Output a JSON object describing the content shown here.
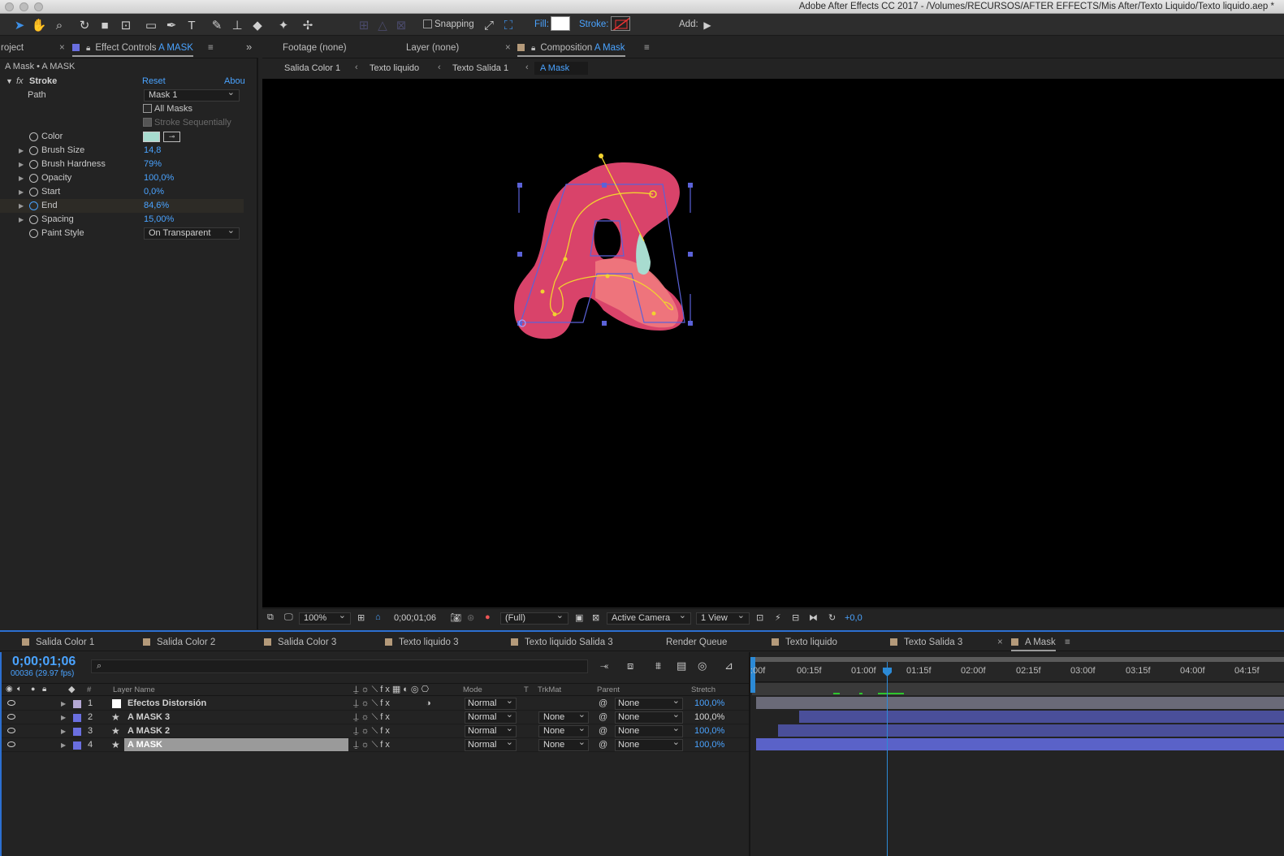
{
  "window": {
    "title": "Adobe After Effects CC 2017 - /Volumes/RECURSOS/AFTER EFFECTS/Mis After/Texto Liquido/Texto liquido.aep *"
  },
  "toolbar": {
    "snapping": "Snapping",
    "fill": "Fill:",
    "stroke": "Stroke:",
    "add": "Add:",
    "icons": [
      "selection-tool",
      "hand-tool",
      "zoom-tool",
      "rotate-tool",
      "camera-tool",
      "pan-behind-tool",
      "rectangle-tool",
      "pen-tool",
      "type-tool",
      "brush-tool",
      "clone-stamp-tool",
      "eraser-tool",
      "roto-brush-tool",
      "puppet-pin-tool"
    ]
  },
  "left_panel": {
    "tab_project": "roject",
    "tab_effect_prefix": "Effect Controls ",
    "tab_effect_layer": "A MASK",
    "breadcrumb": "A Mask • A MASK",
    "effect_name": "Stroke",
    "reset": "Reset",
    "about": "Abou",
    "path_label": "Path",
    "path_value": "Mask 1",
    "all_masks": "All Masks",
    "stroke_seq": "Stroke Sequentially",
    "props": [
      {
        "label": "Color",
        "value": ""
      },
      {
        "label": "Brush Size",
        "value": "14,8"
      },
      {
        "label": "Brush Hardness",
        "value": "79%"
      },
      {
        "label": "Opacity",
        "value": "100,0%"
      },
      {
        "label": "Start",
        "value": "0,0%"
      },
      {
        "label": "End",
        "value": "84,6%"
      },
      {
        "label": "Spacing",
        "value": "15,00%"
      },
      {
        "label": "Paint Style",
        "value": "On Transparent"
      }
    ]
  },
  "viewer_tabs": {
    "footage": "Footage (none)",
    "layer": "Layer (none)",
    "comp_prefix": "Composition ",
    "comp_name": "A Mask",
    "crumbs": [
      "Salida Color 1",
      "Texto liquido",
      "Texto Salida 1",
      "A Mask"
    ]
  },
  "viewer_bar": {
    "zoom": "100%",
    "timecode": "0;00;01;06",
    "resolution": "(Full)",
    "camera": "Active Camera",
    "views": "1 View",
    "exposure": "+0,0"
  },
  "timeline_tabs": [
    "Salida Color 1",
    "Salida Color 2",
    "Salida Color 3",
    "Texto liquido 3",
    "Texto liquido Salida 3",
    "Render Queue",
    "Texto liquido",
    "Texto Salida 3",
    "A Mask"
  ],
  "timeline": {
    "timecode": "0;00;01;06",
    "frames": "00036 (29.97 fps)",
    "headers": {
      "num": "#",
      "layer_name": "Layer Name",
      "mode": "Mode",
      "t": "T",
      "trkmat": "TrkMat",
      "parent": "Parent",
      "stretch": "Stretch"
    },
    "ruler": [
      ":00f",
      "00:15f",
      "01:00f",
      "01:15f",
      "02:00f",
      "02:15f",
      "03:00f",
      "03:15f",
      "04:00f",
      "04:15f"
    ],
    "layers": [
      {
        "num": "1",
        "name": "Efectos Distorsión",
        "mode": "Normal",
        "trkmat": "",
        "parent": "None",
        "stretch": "100,0%"
      },
      {
        "num": "2",
        "name": "A MASK 3",
        "mode": "Normal",
        "trkmat": "None",
        "parent": "None",
        "stretch": "100,0%"
      },
      {
        "num": "3",
        "name": "A MASK 2",
        "mode": "Normal",
        "trkmat": "None",
        "parent": "None",
        "stretch": "100,0%"
      },
      {
        "num": "4",
        "name": "A MASK",
        "mode": "Normal",
        "trkmat": "None",
        "parent": "None",
        "stretch": "100,0%"
      }
    ]
  },
  "colors": {
    "accent": "#4aa3ff",
    "shape": "#d9436a",
    "layer_bar": "#4a4f9a",
    "stroke_color": "#a8dcd0"
  }
}
